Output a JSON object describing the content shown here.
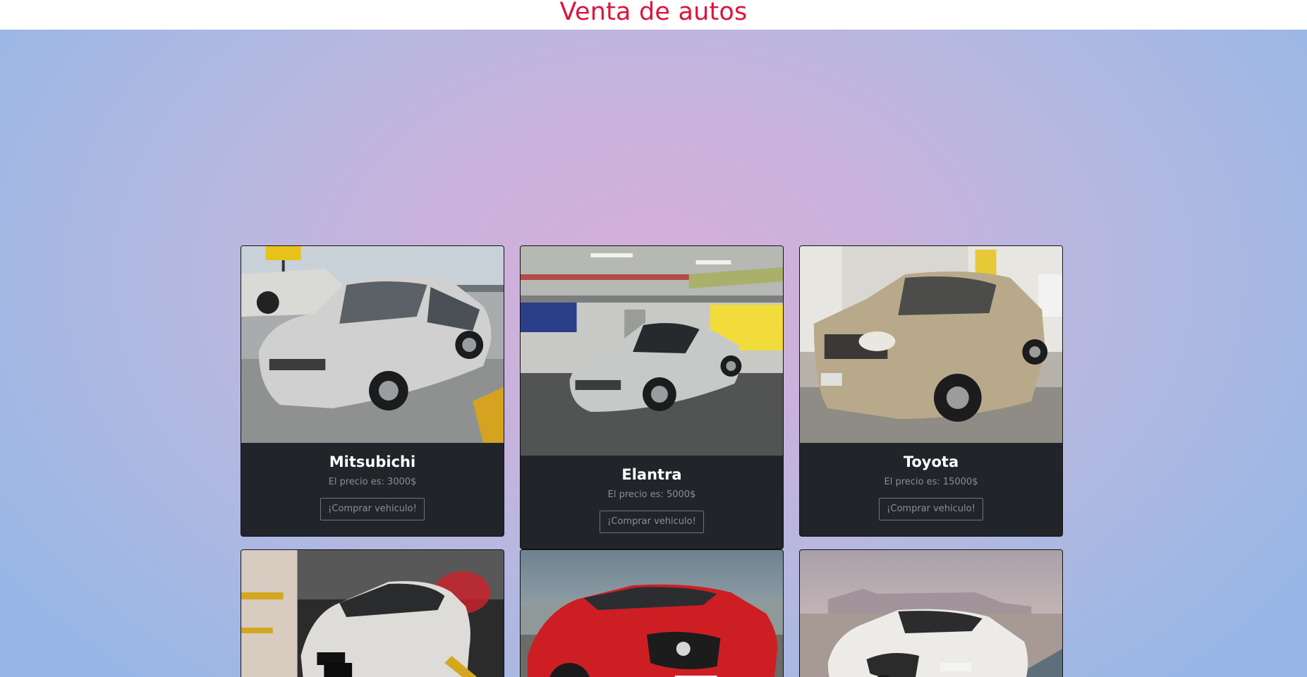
{
  "header": {
    "title": "Venta de autos"
  },
  "buy_label": "¡Comprar vehiculo!",
  "price_prefix": "El precio es:",
  "cars": [
    {
      "name": "Mitsubichi",
      "price": "El precio es: 3000$",
      "button": "¡Comprar vehiculo!",
      "image": "silver-sedan-photo"
    },
    {
      "name": "Elantra",
      "price": "El precio es: 5000$",
      "button": "¡Comprar vehiculo!",
      "image": "silver-sedan-garage-photo"
    },
    {
      "name": "Toyota",
      "price": "El precio es: 15000$",
      "button": "¡Comprar vehiculo!",
      "image": "gold-suv-photo"
    },
    {
      "image": "white-sedan-garage-photo"
    },
    {
      "image": "red-coupe-photo"
    },
    {
      "image": "white-hatchback-photo"
    }
  ],
  "colors": {
    "title": "#dc143c",
    "card_bg": "#212529",
    "text_muted": "#8a8f96",
    "btn_border": "#6c757d"
  }
}
